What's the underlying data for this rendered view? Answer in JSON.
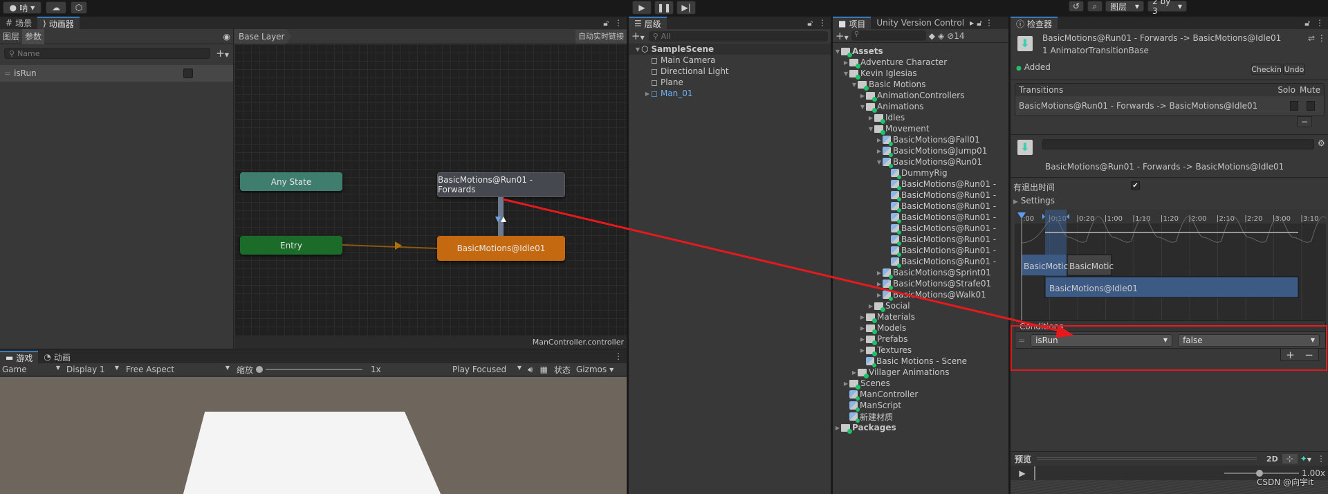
{
  "toolbar": {
    "account": "呐",
    "layers": "图层",
    "layout": "2 by 3"
  },
  "animator": {
    "tabs": [
      "场景",
      "动画器"
    ],
    "subtabs": [
      "图层",
      "参数"
    ],
    "search_placeholder": "Name",
    "params": [
      {
        "name": "isRun",
        "type": "bool",
        "value": false
      }
    ],
    "breadcrumb": "Base Layer",
    "live_link": "自动实时链接",
    "nodes": {
      "any": "Any State",
      "entry": "Entry",
      "run": "BasicMotions@Run01 - Forwards",
      "idle": "BasicMotions@Idle01"
    },
    "footer": "ManController.controller",
    "colors": {
      "any": "#3d7c6d",
      "entry": "#1a6a2a",
      "idle": "#c2680e",
      "run": "#444a52",
      "arrow": "#e8191c"
    }
  },
  "game": {
    "tabs": [
      "游戏",
      "动画"
    ],
    "game_dd": "Game",
    "display": "Display 1",
    "aspect": "Free Aspect",
    "scale_label": "缩放",
    "scale_value": "1x",
    "play_mode": "Play Focused",
    "stats": "状态",
    "gizmos": "Gizmos"
  },
  "hierarchy": {
    "tab": "层级",
    "search_placeholder": "All",
    "items": [
      {
        "label": "SampleScene",
        "level": 0,
        "bold": true
      },
      {
        "label": "Main Camera",
        "level": 1
      },
      {
        "label": "Directional Light",
        "level": 1
      },
      {
        "label": "Plane",
        "level": 1
      },
      {
        "label": "Man_01",
        "level": 1,
        "prefab": true
      }
    ]
  },
  "project": {
    "tabs": [
      "项目",
      "Unity Version Control"
    ],
    "hidden_count": "14",
    "items": [
      {
        "label": "Assets",
        "level": 0,
        "bold": true,
        "arrow": "down"
      },
      {
        "label": "Adventure Character",
        "level": 1,
        "arrow": "right"
      },
      {
        "label": "Kevin Iglesias",
        "level": 1,
        "arrow": "down"
      },
      {
        "label": "Basic Motions",
        "level": 2,
        "arrow": "down"
      },
      {
        "label": "AnimationControllers",
        "level": 3,
        "arrow": "right"
      },
      {
        "label": "Animations",
        "level": 3,
        "arrow": "down"
      },
      {
        "label": "Idles",
        "level": 4,
        "arrow": "right"
      },
      {
        "label": "Movement",
        "level": 4,
        "arrow": "down"
      },
      {
        "label": "BasicMotions@Fall01",
        "level": 5,
        "arrow": "right",
        "clip": true
      },
      {
        "label": "BasicMotions@Jump01",
        "level": 5,
        "arrow": "right",
        "clip": true
      },
      {
        "label": "BasicMotions@Run01",
        "level": 5,
        "arrow": "down",
        "clip": true
      },
      {
        "label": "DummyRig",
        "level": 6,
        "clip": true
      },
      {
        "label": "BasicMotions@Run01 -",
        "level": 6,
        "clip": true
      },
      {
        "label": "BasicMotions@Run01 -",
        "level": 6,
        "clip": true
      },
      {
        "label": "BasicMotions@Run01 -",
        "level": 6,
        "clip": true
      },
      {
        "label": "BasicMotions@Run01 -",
        "level": 6,
        "clip": true
      },
      {
        "label": "BasicMotions@Run01 -",
        "level": 6,
        "clip": true
      },
      {
        "label": "BasicMotions@Run01 -",
        "level": 6,
        "clip": true
      },
      {
        "label": "BasicMotions@Run01 -",
        "level": 6,
        "clip": true
      },
      {
        "label": "BasicMotions@Run01 -",
        "level": 6,
        "clip": true
      },
      {
        "label": "BasicMotions@Sprint01",
        "level": 5,
        "arrow": "right",
        "clip": true
      },
      {
        "label": "BasicMotions@Strafe01",
        "level": 5,
        "arrow": "right",
        "clip": true
      },
      {
        "label": "BasicMotions@Walk01",
        "level": 5,
        "arrow": "right",
        "clip": true
      },
      {
        "label": "Social",
        "level": 4,
        "arrow": "right"
      },
      {
        "label": "Materials",
        "level": 3,
        "arrow": "right"
      },
      {
        "label": "Models",
        "level": 3,
        "arrow": "right"
      },
      {
        "label": "Prefabs",
        "level": 3,
        "arrow": "right"
      },
      {
        "label": "Textures",
        "level": 3,
        "arrow": "right"
      },
      {
        "label": "Basic Motions - Scene",
        "level": 3,
        "clip": true
      },
      {
        "label": "Villager Animations",
        "level": 2,
        "arrow": "right"
      },
      {
        "label": "Scenes",
        "level": 1,
        "arrow": "right"
      },
      {
        "label": "ManController",
        "level": 1,
        "clip": true
      },
      {
        "label": "ManScript",
        "level": 1,
        "clip": true
      },
      {
        "label": "新建材质",
        "level": 1,
        "clip": true
      },
      {
        "label": "Packages",
        "level": 0,
        "bold": true,
        "arrow": "right"
      }
    ]
  },
  "inspector": {
    "tab": "检查器",
    "title": "BasicMotions@Run01 - Forwards -> BasicMotions@Idle01",
    "subtitle": "1 AnimatorTransitionBase",
    "status": "Added",
    "checkin": "Checkin",
    "undo": "Undo",
    "transitions_header": "Transitions",
    "solo": "Solo",
    "mute": "Mute",
    "transition_row": "BasicMotions@Run01 - Forwards -> BasicMotions@Idle01",
    "minus": "−",
    "transition_title": "BasicMotions@Run01 - Forwards -> BasicMotions@Idle01",
    "has_exit_time_label": "有退出时间",
    "has_exit_time": true,
    "settings": "Settings",
    "timeline_ticks": [
      ":00",
      "0:10",
      "0:20",
      "1:00",
      "1:10",
      "1:20",
      "2:00",
      "2:10",
      "2:20",
      "3:00",
      "3:10"
    ],
    "clip_a": "BasicMotic",
    "clip_b": "BasicMotic",
    "clip_idle": "BasicMotions@Idle01",
    "conditions": "Conditions",
    "condition": {
      "param": "isRun",
      "value": "false"
    },
    "plus": "+",
    "preview": "预览",
    "mode2d": "2D",
    "speed": "1.00x",
    "watermark": "CSDN @向宇it"
  }
}
